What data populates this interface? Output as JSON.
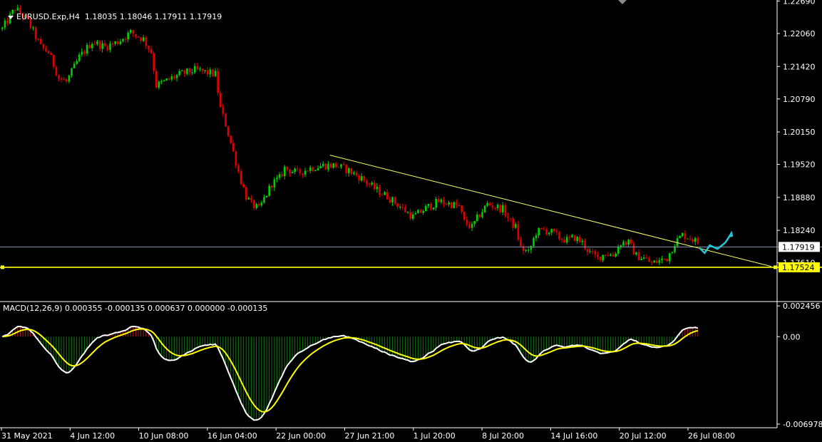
{
  "header": {
    "menu_icon": "triangle-down-icon",
    "symbol": "EURUSD.Exp,H4",
    "ohlc": "1.18035 1.18046 1.17911 1.17919",
    "indicator": "MACD(12,26,9) 0.000355 -0.000135 0.000637 0.000000 -0.000135",
    "scroll_marker_icon": "chart-shift-marker-icon"
  },
  "colors": {
    "background": "#000000",
    "bull": "#00d000",
    "bear": "#e00000",
    "trendline": "#ffff66",
    "support_line": "#ffff00",
    "current_price_line": "#8898b0",
    "macd_main": "#ffffff",
    "macd_signal": "#ffff00",
    "histogram_pos": "#c01818",
    "histogram_neg": "#0a7a0a",
    "projection": "#22c8d8",
    "axis": "#ffffff"
  },
  "chart_data": [
    {
      "type": "candlestick",
      "price_axis": {
        "ticks": [
          "1.22690",
          "1.22060",
          "1.21420",
          "1.20790",
          "1.20150",
          "1.19520",
          "1.18880",
          "1.18240",
          "1.17610"
        ],
        "range": [
          1.169,
          1.2271
        ]
      },
      "time_axis": {
        "labels": [
          "31 May 2021",
          "4 Jun 12:00",
          "10 Jun 08:00",
          "16 Jun 04:00",
          "22 Jun 00:00",
          "27 Jun 21:00",
          "1 Jul 20:00",
          "8 Jul 20:00",
          "14 Jul 16:00",
          "20 Jul 12:00",
          "26 Jul 08:00"
        ]
      },
      "price_labels": [
        {
          "name": "current",
          "value": "1.17919"
        },
        {
          "name": "support",
          "value": "1.17524"
        }
      ],
      "path_points": [
        [
          0,
          1.2215
        ],
        [
          5,
          1.2255
        ],
        [
          10,
          1.223
        ],
        [
          15,
          1.218
        ],
        [
          18,
          1.217
        ],
        [
          22,
          1.212
        ],
        [
          25,
          1.2112
        ],
        [
          30,
          1.216
        ],
        [
          35,
          1.219
        ],
        [
          40,
          1.218
        ],
        [
          45,
          1.219
        ],
        [
          50,
          1.2208
        ],
        [
          55,
          1.2195
        ],
        [
          58,
          1.217
        ],
        [
          60,
          1.2105
        ],
        [
          63,
          1.2112
        ],
        [
          67,
          1.2122
        ],
        [
          70,
          1.2128
        ],
        [
          75,
          1.2135
        ],
        [
          80,
          1.213
        ],
        [
          83,
          1.2127
        ],
        [
          85,
          1.206
        ],
        [
          87,
          1.203
        ],
        [
          90,
          1.1975
        ],
        [
          93,
          1.192
        ],
        [
          95,
          1.189
        ],
        [
          97,
          1.1875
        ],
        [
          100,
          1.1865
        ],
        [
          103,
          1.1895
        ],
        [
          105,
          1.1915
        ],
        [
          108,
          1.1925
        ],
        [
          110,
          1.1945
        ],
        [
          115,
          1.1935
        ],
        [
          120,
          1.1945
        ],
        [
          125,
          1.195
        ],
        [
          130,
          1.195
        ],
        [
          135,
          1.194
        ],
        [
          140,
          1.1925
        ],
        [
          145,
          1.1905
        ],
        [
          150,
          1.189
        ],
        [
          155,
          1.187
        ],
        [
          160,
          1.185
        ],
        [
          163,
          1.186
        ],
        [
          166,
          1.187
        ],
        [
          170,
          1.188
        ],
        [
          175,
          1.1875
        ],
        [
          178,
          1.187
        ],
        [
          180,
          1.184
        ],
        [
          183,
          1.183
        ],
        [
          186,
          1.1855
        ],
        [
          189,
          1.1875
        ],
        [
          192,
          1.187
        ],
        [
          195,
          1.1865
        ],
        [
          198,
          1.184
        ],
        [
          200,
          1.183
        ],
        [
          202,
          1.179
        ],
        [
          205,
          1.178
        ],
        [
          208,
          1.182
        ],
        [
          211,
          1.1825
        ],
        [
          214,
          1.182
        ],
        [
          217,
          1.181
        ],
        [
          220,
          1.1805
        ],
        [
          223,
          1.181
        ],
        [
          226,
          1.18
        ],
        [
          229,
          1.178
        ],
        [
          232,
          1.177
        ],
        [
          235,
          1.178
        ],
        [
          238,
          1.1775
        ],
        [
          241,
          1.18
        ],
        [
          244,
          1.18
        ],
        [
          247,
          1.1775
        ],
        [
          250,
          1.177
        ],
        [
          253,
          1.176
        ],
        [
          256,
          1.1765
        ],
        [
          259,
          1.177
        ],
        [
          262,
          1.18
        ],
        [
          265,
          1.1815
        ],
        [
          268,
          1.181
        ],
        [
          271,
          1.18
        ]
      ],
      "extra_bars": 272,
      "trendline": {
        "from": {
          "bar": 128,
          "price": 1.197
        },
        "to": {
          "bar": 300,
          "price": 1.1754
        }
      },
      "support_level": 1.17524,
      "current_price": 1.17919,
      "projection": [
        [
          272,
          1.179
        ],
        [
          274,
          1.178
        ],
        [
          276,
          1.1795
        ],
        [
          279,
          1.1788
        ],
        [
          282,
          1.18
        ],
        [
          284,
          1.1815
        ]
      ]
    },
    {
      "type": "macd",
      "fast": 12,
      "slow": 26,
      "signal": 9,
      "axis_ticks": [
        "0.002456",
        "0.00",
        "-0.006978"
      ],
      "range": [
        -0.007268,
        0.002746
      ]
    }
  ]
}
